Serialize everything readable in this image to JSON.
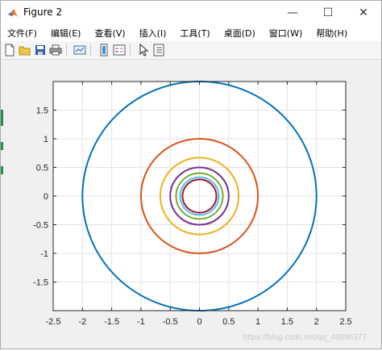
{
  "window": {
    "title": "Figure 2"
  },
  "window_controls": {
    "minimize": "—",
    "maximize": "☐",
    "close": "✕"
  },
  "menu": [
    {
      "label": "文件(F)"
    },
    {
      "label": "编辑(E)"
    },
    {
      "label": "查看(V)"
    },
    {
      "label": "插入(I)"
    },
    {
      "label": "工具(T)"
    },
    {
      "label": "桌面(D)"
    },
    {
      "label": "窗口(W)"
    },
    {
      "label": "帮助(H)"
    }
  ],
  "toolbar": [
    {
      "icon": "new-figure-icon"
    },
    {
      "icon": "open-file-icon"
    },
    {
      "icon": "save-icon"
    },
    {
      "icon": "print-icon"
    },
    {
      "icon": "link-plot-icon"
    },
    {
      "icon": "insert-colorbar-icon"
    },
    {
      "icon": "insert-legend-icon"
    },
    {
      "icon": "select-arrow-icon"
    },
    {
      "icon": "property-inspector-icon"
    }
  ],
  "watermark": "https://blog.csdn.net/qq_46696377",
  "chart_data": {
    "type": "line",
    "title": "",
    "xlabel": "",
    "ylabel": "",
    "xlim": [
      -2.5,
      2.5
    ],
    "ylim": [
      -2,
      2
    ],
    "xticks": [
      -2.5,
      -2,
      -1.5,
      -1,
      -0.5,
      0,
      0.5,
      1,
      1.5,
      2,
      2.5
    ],
    "xtick_labels": [
      "-2.5",
      "-2",
      "-1.5",
      "-1",
      "-0.5",
      "0",
      "0.5",
      "1",
      "1.5",
      "2",
      "2.5"
    ],
    "yticks": [
      -1.5,
      -1,
      -0.5,
      0,
      0.5,
      1,
      1.5
    ],
    "ytick_labels": [
      "-1.5",
      "-1",
      "-0.5",
      "0",
      "0.5",
      "1",
      "1.5"
    ],
    "grid": true,
    "series": [
      {
        "radius": 2.0,
        "color": "#0072BD"
      },
      {
        "radius": 1.0,
        "color": "#D95319"
      },
      {
        "radius": 0.67,
        "color": "#EDB120"
      },
      {
        "radius": 0.5,
        "color": "#7E2F8E"
      },
      {
        "radius": 0.4,
        "color": "#77AC30"
      },
      {
        "radius": 0.33,
        "color": "#4DBEEE"
      },
      {
        "radius": 0.29,
        "color": "#A2142F"
      }
    ]
  }
}
